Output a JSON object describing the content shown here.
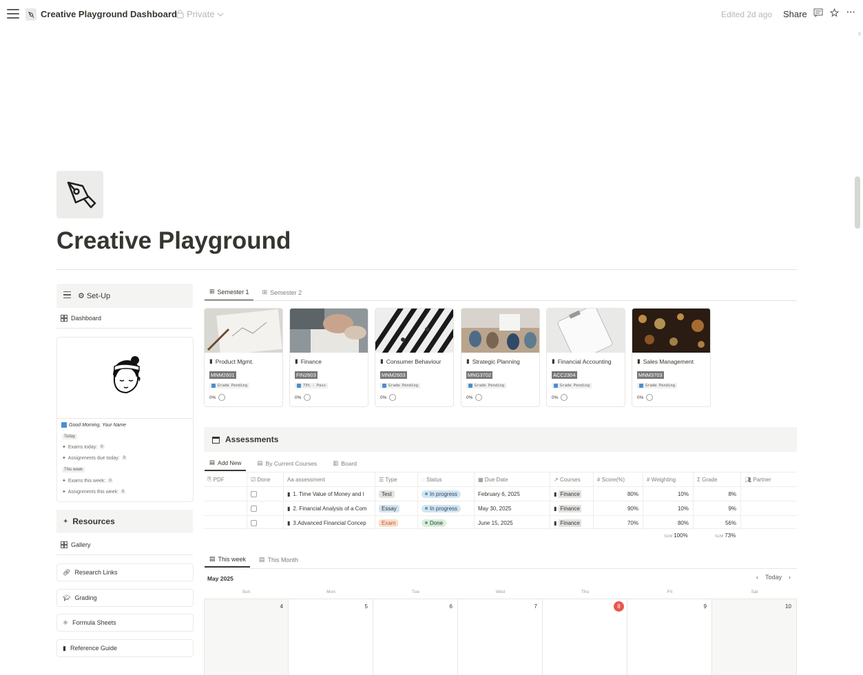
{
  "topbar": {
    "title": "Creative Playground Dashboard",
    "privacy": "Private",
    "edited": "Edited 2d ago",
    "share": "Share"
  },
  "page": {
    "title": "Creative Playground"
  },
  "sidebar": {
    "setup_label": "Set-Up",
    "dashboard_tab": "Dashboard",
    "greeting": "Good Morning, Your Name",
    "today_tag": "Today",
    "exams_today": "Exams today:",
    "exams_today_count": "0",
    "assign_today": "Assignments due today:",
    "assign_today_count": "0",
    "week_tag": "This week",
    "exams_week": "Exams this week:",
    "exams_week_count": "0",
    "assign_week": "Assignments this week:",
    "assign_week_count": "0",
    "resources_title": "Resources",
    "gallery_tab": "Gallery",
    "resources": [
      "Research Links",
      "Grading",
      "Formula Sheets",
      "Reference Guide"
    ]
  },
  "semester_tabs": [
    "Semester 1",
    "Semester 2"
  ],
  "courses": [
    {
      "name": "Product Mgmt.",
      "code": "MNM2601",
      "grade": "Grade Pending",
      "progress": "0%"
    },
    {
      "name": "Finance",
      "code": "FIN2603",
      "grade": "73% - Pass",
      "progress": "0%"
    },
    {
      "name": "Consumer Behaviour",
      "code": "MNM2603",
      "grade": "Grade Pending",
      "progress": "0%"
    },
    {
      "name": "Strategic Planning",
      "code": "MNG3702",
      "grade": "Grade Pending",
      "progress": "0%"
    },
    {
      "name": "Financial Accounting",
      "code": "ACC2304",
      "grade": "Grade Pending",
      "progress": "0%"
    },
    {
      "name": "Sales Management",
      "code": "MNM3703",
      "grade": "Grade Pending",
      "progress": "0%"
    }
  ],
  "assessments": {
    "title": "Assessments",
    "tabs": [
      "Add New",
      "By Current Courses",
      "Board"
    ],
    "columns": [
      "PDF",
      "Done",
      "assessment",
      "Type",
      "Status",
      "Due Date",
      "Courses",
      "Score(%)",
      "Weighting",
      "Grade",
      "Partner"
    ],
    "rows": [
      {
        "assessment": "1. Time Value of Money and I",
        "type": "Test",
        "status": "In progress",
        "due": "February 6, 2025",
        "course": "Finance",
        "score": "80%",
        "weight": "10%",
        "grade": "8%"
      },
      {
        "assessment": "2. Financial Analysis of a Com",
        "type": "Essay",
        "status": "In progress",
        "due": "May 30, 2025",
        "course": "Finance",
        "score": "90%",
        "weight": "10%",
        "grade": "9%"
      },
      {
        "assessment": "3.Advanced Financial Concep",
        "type": "Exam",
        "status": "Done",
        "due": "June 15, 2025",
        "course": "Finance",
        "score": "70%",
        "weight": "80%",
        "grade": "56%"
      }
    ],
    "sum_label": "SUM",
    "sum_weight": "100%",
    "sum_grade": "73%"
  },
  "calendar": {
    "tabs": [
      "This week",
      "This Month"
    ],
    "month": "May 2025",
    "today_btn": "Today",
    "days": [
      "Sun",
      "Mon",
      "Tue",
      "Wed",
      "Thu",
      "Fri",
      "Sat"
    ],
    "dates": [
      "4",
      "5",
      "6",
      "7",
      "8",
      "9",
      "10"
    ],
    "today_index": 4
  },
  "colors": {
    "today_badge": "#e8574d",
    "in_progress_bg": "#d3e5ef",
    "done_bg": "#dbeddb"
  }
}
